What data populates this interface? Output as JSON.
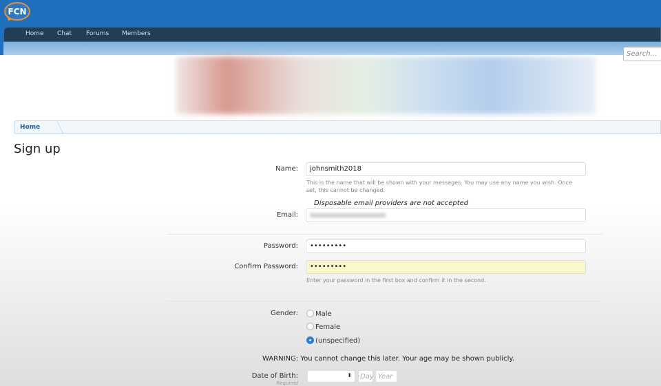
{
  "header": {
    "logo": "FCN",
    "nav": [
      "Home",
      "Chat",
      "Forums",
      "Members"
    ],
    "search_placeholder": "Search..."
  },
  "breadcrumb": {
    "home": "Home"
  },
  "page": {
    "title": "Sign up"
  },
  "form": {
    "name_label": "Name:",
    "name_value": "johnsmith2018",
    "name_hint": "This is the name that will be shown with your messages. You may use any name you wish. Once set, this cannot be changed.",
    "email_notice": "Disposable email providers are not accepted",
    "email_label": "Email:",
    "password_label": "Password:",
    "password_value": "•••••••••",
    "confirm_label": "Confirm Password:",
    "confirm_value": "•••••••••",
    "password_hint": "Enter your password in the first box and confirm it in the second.",
    "gender_label": "Gender:",
    "gender_options": [
      "Male",
      "Female",
      "(unspecified)"
    ],
    "gender_selected": "(unspecified)",
    "warning": "WARNING: You cannot change this later. Your age may be shown publicly.",
    "dob_label": "Date of Birth:",
    "dob_required": "Required",
    "day_placeholder": "Day",
    "year_placeholder": "Year"
  }
}
